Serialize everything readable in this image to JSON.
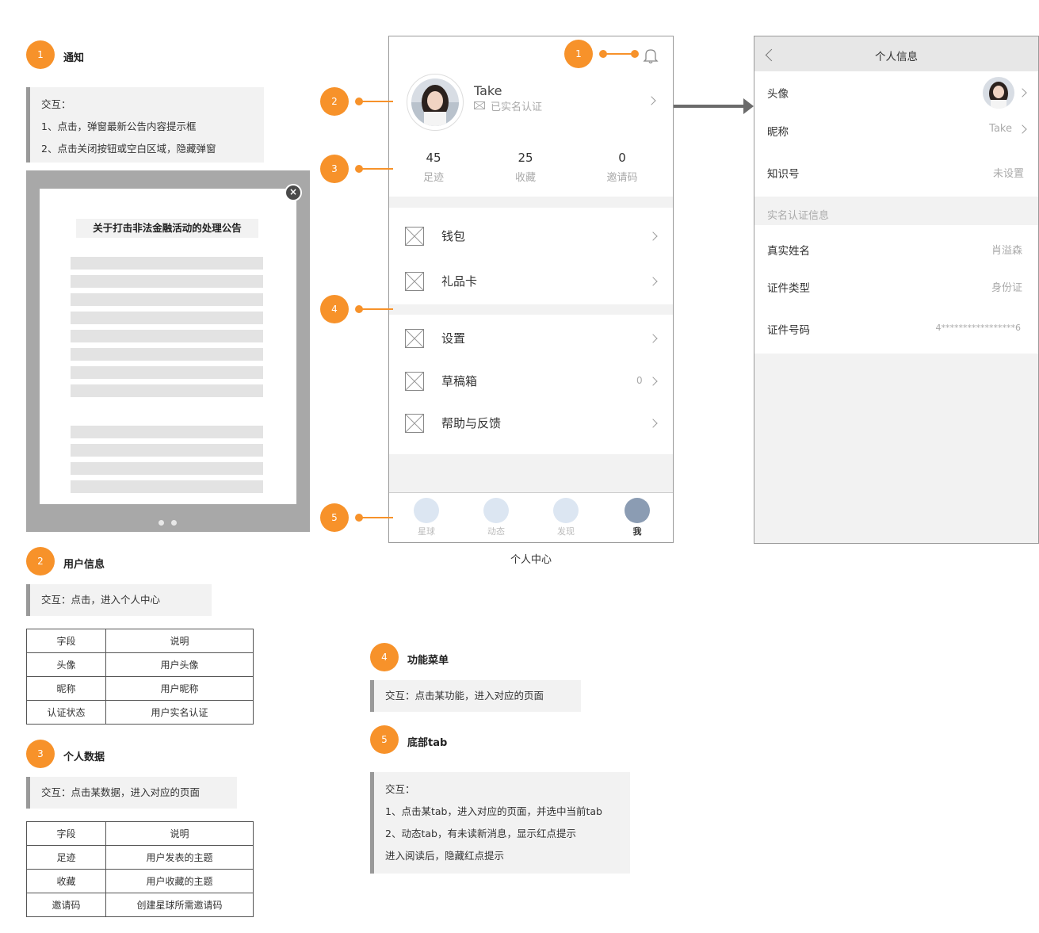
{
  "sections": {
    "notice": {
      "badge": "1",
      "title": "通知",
      "lines": [
        "交互：",
        "1、点击，弹窗最新公告内容提示框",
        "2、点击关闭按钮或空白区域，隐藏弹窗"
      ]
    },
    "user": {
      "badge": "2",
      "title": "用户信息",
      "lines": [
        "交互：点击，进入个人中心"
      ]
    },
    "data": {
      "badge": "3",
      "title": "个人数据",
      "lines": [
        "交互：点击某数据，进入对应的页面"
      ]
    },
    "menu": {
      "badge": "4",
      "title": "功能菜单",
      "lines": [
        "交互：点击某功能，进入对应的页面"
      ]
    },
    "tabbar": {
      "badge": "5",
      "title": "底部tab",
      "lines": [
        "交互：",
        "1、点击某tab，进入对应的页面，并选中当前tab",
        "2、动态tab，有未读新消息，显示红点提示",
        "进入阅读后，隐藏红点提示"
      ]
    }
  },
  "table_user": [
    [
      "字段",
      "说明"
    ],
    [
      "头像",
      "用户头像"
    ],
    [
      "昵称",
      "用户昵称"
    ],
    [
      "认证状态",
      "用户实名认证"
    ]
  ],
  "table_data": [
    [
      "字段",
      "说明"
    ],
    [
      "足迹",
      "用户发表的主题"
    ],
    [
      "收藏",
      "用户收藏的主题"
    ],
    [
      "邀请码",
      "创建星球所需邀请码"
    ]
  ],
  "popup": {
    "title": "关于打击非法金融活动的处理公告",
    "close": "×"
  },
  "phone": {
    "caption": "个人中心",
    "badges": [
      "1",
      "2",
      "3",
      "4",
      "5"
    ],
    "user_name": "Take",
    "verified_text": "已实名认证",
    "stats": [
      {
        "value": "45",
        "label": "足迹"
      },
      {
        "value": "25",
        "label": "收藏"
      },
      {
        "value": "0",
        "label": "邀请码"
      }
    ],
    "menu": [
      {
        "label": "钱包",
        "count": ""
      },
      {
        "label": "礼品卡",
        "count": ""
      },
      {
        "label": "设置",
        "count": ""
      },
      {
        "label": "草稿箱",
        "count": "0"
      },
      {
        "label": "帮助与反馈",
        "count": ""
      }
    ],
    "tabs": [
      {
        "label": "星球",
        "active": false
      },
      {
        "label": "动态",
        "active": false
      },
      {
        "label": "发现",
        "active": false
      },
      {
        "label": "我",
        "active": true
      }
    ],
    "colors": {
      "accent": "#f7922a",
      "tab_inactive": "#dce6f2",
      "tab_active": "#8b9cb3"
    }
  },
  "detail": {
    "title": "个人信息",
    "rows": [
      {
        "key": "头像",
        "value": ""
      },
      {
        "key": "昵称",
        "value": "Take"
      },
      {
        "key": "知识号",
        "value": "未设置"
      }
    ],
    "section_label": "实名认证信息",
    "rows2": [
      {
        "key": "真实姓名",
        "value": "肖溢森"
      },
      {
        "key": "证件类型",
        "value": "身份证"
      },
      {
        "key": "证件号码",
        "value": "4*****************6"
      }
    ]
  }
}
